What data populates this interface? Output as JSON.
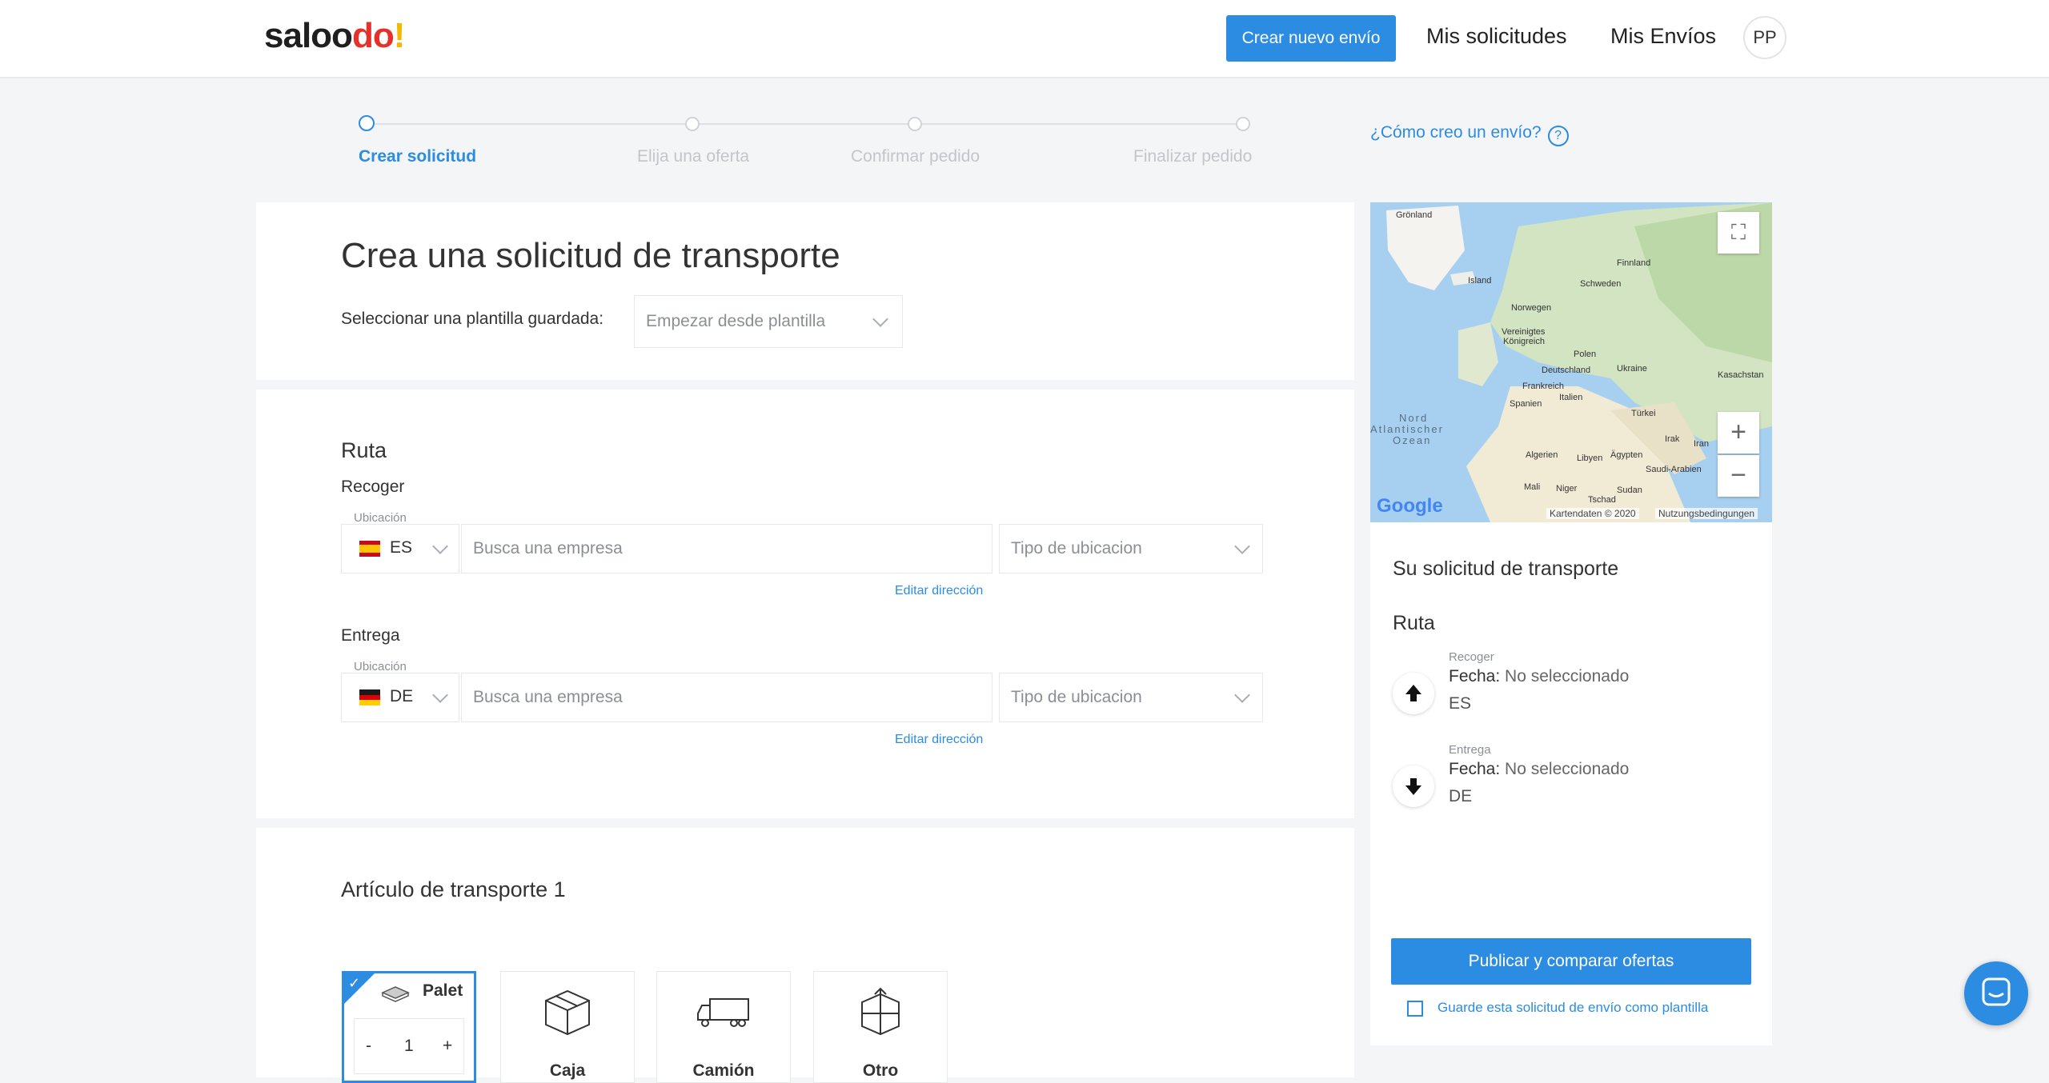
{
  "header": {
    "logo": {
      "part1": "sal",
      "part2": "oo",
      "part3": "do",
      "part4": "!"
    },
    "new_shipment_label": "Crear nuevo envío",
    "my_requests_label": "Mis solicitudes",
    "my_shipments_label": "Mis Envíos",
    "avatar_initials": "PP"
  },
  "stepper": {
    "steps": [
      "Crear solicitud",
      "Elija una oferta",
      "Confirmar pedido",
      "Finalizar pedido"
    ]
  },
  "help": {
    "label": "¿Cómo creo un envío?",
    "icon": "?"
  },
  "template_card": {
    "title": "Crea una solicitud de transporte",
    "select_label": "Seleccionar una plantilla guardada:",
    "select_placeholder": "Empezar desde plantilla"
  },
  "route_card": {
    "title": "Ruta",
    "pickup": {
      "label": "Recoger",
      "location_label": "Ubicación",
      "country": "ES",
      "search_placeholder": "Busca una empresa",
      "type_placeholder": "Tipo de ubicacion",
      "edit_link": "Editar dirección"
    },
    "delivery": {
      "label": "Entrega",
      "location_label": "Ubicación",
      "country": "DE",
      "search_placeholder": "Busca una empresa",
      "type_placeholder": "Tipo de ubicacion",
      "edit_link": "Editar dirección"
    }
  },
  "items_card": {
    "title": "Artículo de transporte 1",
    "types": [
      {
        "label": "Palet",
        "icon": "pallet-icon",
        "selected": true
      },
      {
        "label": "Caja",
        "icon": "box-icon",
        "selected": false
      },
      {
        "label": "Camión",
        "icon": "truck-icon",
        "selected": false
      },
      {
        "label": "Otro",
        "icon": "other-icon",
        "selected": false
      }
    ],
    "quantity": {
      "minus": "-",
      "value": "1",
      "plus": "+"
    }
  },
  "map": {
    "labels": [
      "Grönland",
      "Island",
      "Finnland",
      "Schweden",
      "Norwegen",
      "Vereinigtes",
      "Königreich",
      "Polen",
      "Deutschland",
      "Ukraine",
      "Frankreich",
      "Kasachstan",
      "Italien",
      "Spanien",
      "Türkei",
      "Nord",
      "Atlantischer",
      "Ozean",
      "Irak",
      "Iran",
      "Algerien",
      "Libyen",
      "Ägypten",
      "Saudi-Arabien",
      "Mali",
      "Niger",
      "Tschad",
      "Sudan"
    ],
    "google_label": "Google",
    "attribution": "Kartendaten © 2020",
    "terms": "Nutzungsbedingungen",
    "zoom_in": "+",
    "zoom_out": "−"
  },
  "summary": {
    "title": "Su solicitud de transporte",
    "route_title": "Ruta",
    "pickup": {
      "label": "Recoger",
      "date_label": "Fecha:",
      "date_value": "No seleccionado",
      "country": "ES"
    },
    "delivery": {
      "label": "Entrega",
      "date_label": "Fecha:",
      "date_value": "No seleccionado",
      "country": "DE"
    },
    "publish_label": "Publicar y comparar ofertas",
    "save_template_label": "Guarde esta solicitud de envío como plantilla"
  },
  "colors": {
    "accent": "#2b8ce2",
    "logo_red": "#e4312b",
    "logo_yellow": "#f5b800"
  }
}
